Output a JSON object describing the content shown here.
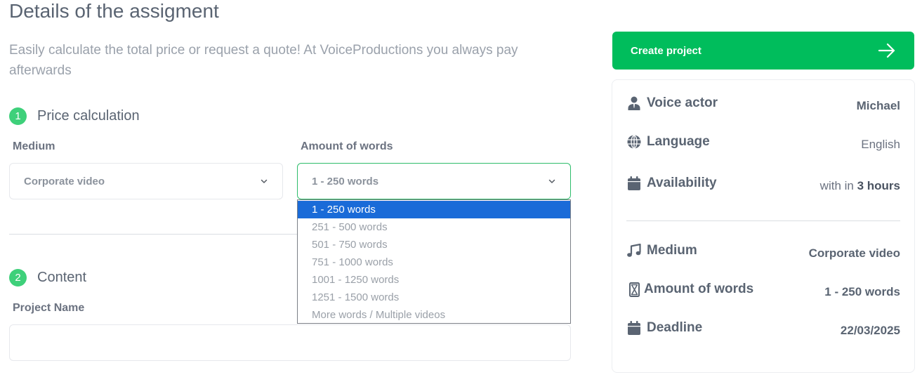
{
  "page": {
    "title": "Details of the assigment",
    "intro": "Easily calculate the total price or request a quote! At VoiceProductions you always pay afterwards"
  },
  "steps": [
    {
      "number": "1",
      "title": "Price calculation"
    },
    {
      "number": "2",
      "title": "Content"
    }
  ],
  "form": {
    "medium_label": "Medium",
    "medium_value": "Corporate video",
    "words_label": "Amount of words",
    "words_value": "1 - 250 words",
    "project_name_label": "Project Name",
    "project_name_value": ""
  },
  "words_dropdown": {
    "options": [
      "1 - 250 words",
      "251 - 500 words",
      "501 - 750 words",
      "751 - 1000 words",
      "1001 - 1250 words",
      "1251 - 1500 words",
      "More words / Multiple videos"
    ],
    "selected_index": 0
  },
  "cta": {
    "label": "Create project",
    "icon": "arrow-right-icon"
  },
  "summary": {
    "voice_actor": {
      "label": "Voice actor",
      "value": "Michael",
      "icon": "user-icon"
    },
    "language": {
      "label": "Language",
      "value": "English",
      "icon": "globe-icon"
    },
    "availability": {
      "label": "Availability",
      "prefix": "with in",
      "value": "3 hours",
      "icon": "calendar-icon"
    },
    "medium": {
      "label": "Medium",
      "value": "Corporate video",
      "icon": "music-note-icon"
    },
    "words": {
      "label": "Amount of words",
      "value": "1 - 250 words",
      "icon": "hourglass-icon"
    },
    "deadline": {
      "label": "Deadline",
      "value": "22/03/2025",
      "icon": "calendar-icon"
    }
  },
  "colors": {
    "accent_green": "#00bd5c",
    "step_badge": "#3ed07a",
    "selected_option": "#1a6bd8",
    "text": "#5a6472",
    "muted_text": "#9aa1ab"
  }
}
